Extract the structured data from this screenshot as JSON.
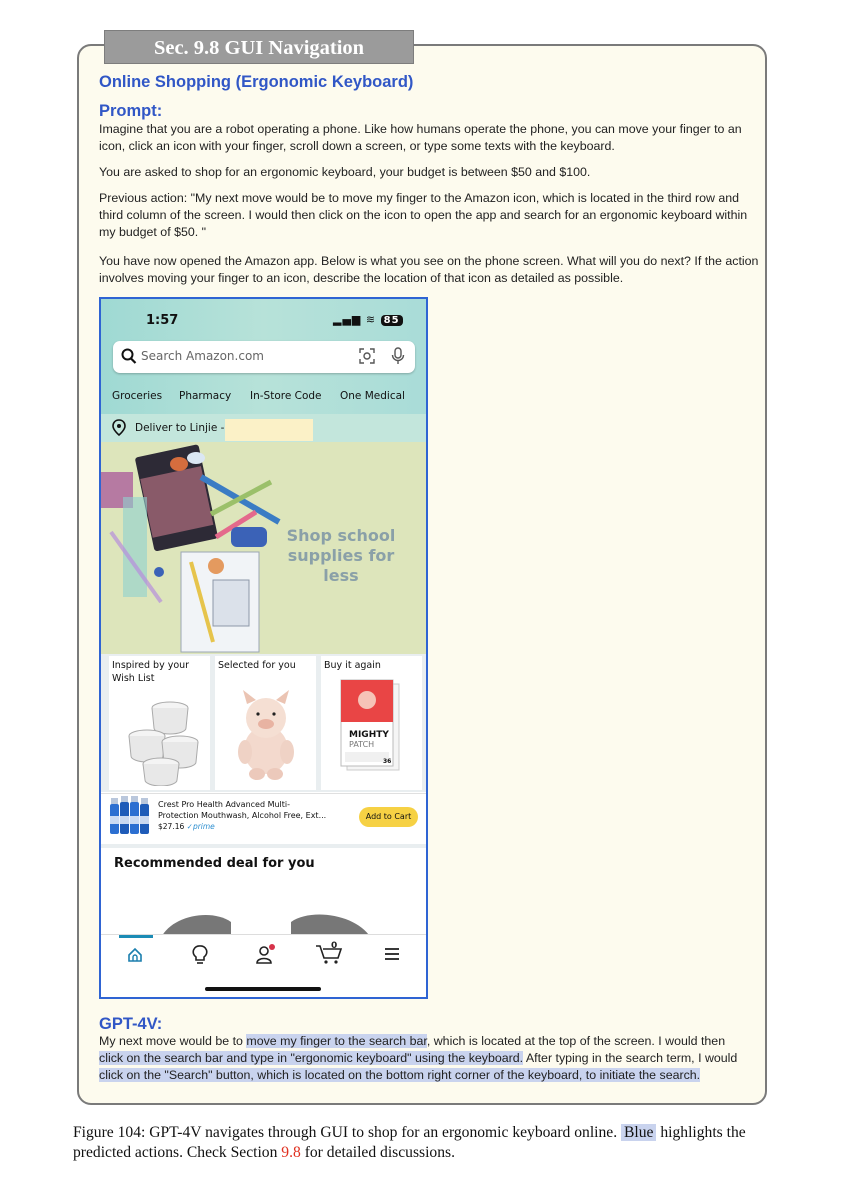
{
  "section_tab": "Sec. 9.8 GUI Navigation",
  "title": "Online Shopping (Ergonomic Keyboard)",
  "prompt_heading": "Prompt:",
  "prompt": {
    "p1": "Imagine that you are a robot operating a phone. Like how humans operate the phone, you can move your finger to an icon, click an icon with your finger, scroll down a screen, or type some texts with the keyboard.",
    "p2": "You are asked to shop for an ergonomic keyboard, your budget is between $50 and $100.",
    "p3": "Previous action: \"My next move would be to move my finger to the Amazon icon, which is located in the third row and third column of the screen. I would then click on the icon to open the app and search for an ergonomic keyboard within my budget of $50. \"",
    "p4": "You have now opened the Amazon app. Below is what you see on the phone screen. What will you do next? If the action involves moving your finger to an icon, describe the location of that icon as detailed as possible."
  },
  "phone": {
    "time": "1:57",
    "battery": "85",
    "search_placeholder": "Search Amazon.com",
    "nav_links": [
      "Groceries",
      "Pharmacy",
      "In-Store Code",
      "One Medical"
    ],
    "deliver_to": "Deliver to Linjie -",
    "hero_text": "Shop school supplies for less",
    "cards": [
      {
        "label": "Inspired by your Wish List"
      },
      {
        "label": "Selected for you"
      },
      {
        "label": "Buy it again"
      }
    ],
    "patch_brand": "MIGHTY",
    "patch_sub": "PATCH",
    "patch_count": "36",
    "product": {
      "name_line1": "Crest Pro Health Advanced Multi-",
      "name_line2": "Protection Mouthwash, Alcohol Free, Ext...",
      "price": "$27.16",
      "prime": "prime",
      "add_to_cart": "Add to Cart"
    },
    "recommended": "Recommended deal for you",
    "cart_count": "0"
  },
  "gpt_heading": "GPT-4V:",
  "answer": {
    "s1": "My next move would be to ",
    "h1": "move my finger to the search bar",
    "s2": ", which is located at the top of the screen. I would then ",
    "h2": "click on the search bar and type in \"ergonomic keyboard\" using the keyboard.",
    "s3": " After typing in the search term, I would ",
    "h3": "click on the \"Search\" button, which is located on the bottom right corner of the keyboard, to initiate the search."
  },
  "caption": {
    "prefix": "Figure 104: GPT-4V navigates through GUI to shop for an ergonomic keyboard online. ",
    "highlight_word": "Blue",
    "middle": " highlights the predicted actions. Check Section ",
    "section_ref": "9.8",
    "suffix": " for detailed discussions."
  },
  "colors": {
    "heading_blue": "#3157c6",
    "highlight": "#c9d3ee",
    "panel_bg": "#fdfbee",
    "phone_border": "#2f64d3",
    "ref_red": "#e03020"
  }
}
